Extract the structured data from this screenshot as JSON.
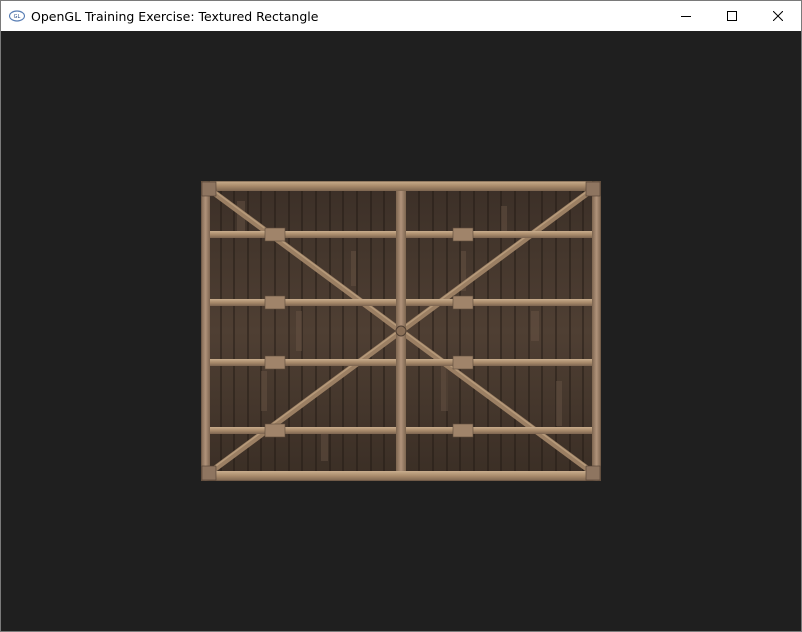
{
  "window": {
    "title": "OpenGL Training Exercise: Textured Rectangle",
    "app_icon": "opengl-logo-icon",
    "controls": [
      {
        "name": "minimize",
        "icon": "minimize-icon"
      },
      {
        "name": "maximize",
        "icon": "maximize-icon"
      },
      {
        "name": "close",
        "icon": "close-icon"
      }
    ]
  },
  "viewport": {
    "clear_color": "#1f1f1f",
    "object": {
      "type": "textured-rectangle",
      "texture": "wooden-crate-panel",
      "plank_color": "#4a3b30",
      "frame_color": "#9e8266",
      "frame_highlight": "#c4a887"
    }
  }
}
